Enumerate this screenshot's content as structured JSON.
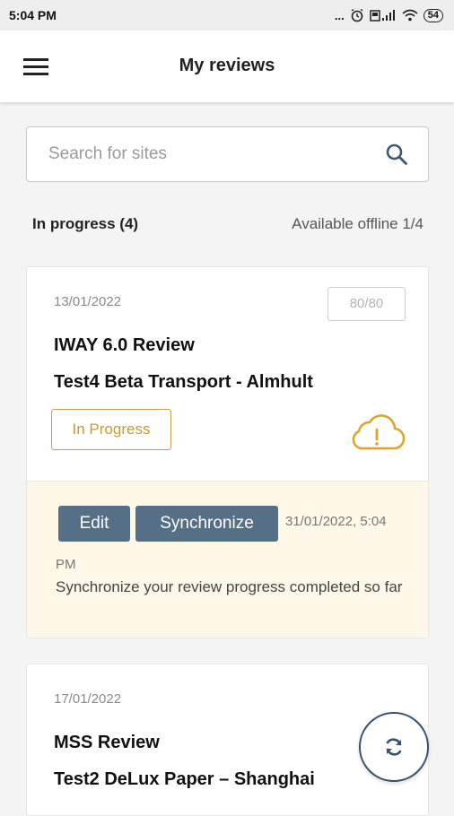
{
  "status_bar": {
    "time": "5:04 PM",
    "indicators": "...",
    "battery": "54"
  },
  "app_bar": {
    "title": "My reviews",
    "menu_icon": "hamburger-menu-icon"
  },
  "search": {
    "placeholder": "Search for sites",
    "value": "",
    "icon": "search-icon"
  },
  "section": {
    "title": "In progress (4)",
    "offline_status": "Available offline 1/4"
  },
  "reviews": [
    {
      "date": "13/01/2022",
      "score": "80/80",
      "review_name": "IWAY 6.0 Review",
      "site_name": "Test4 Beta Transport - Almhult",
      "status": "In Progress",
      "sync_icon": "cloud-warning-icon",
      "edit_label": "Edit",
      "sync_label": "Synchronize",
      "sync_date_part1": "31/01/2022, 5:04",
      "sync_date_part2": "PM",
      "sync_message": "Synchronize your review progress completed so far"
    },
    {
      "date": "17/01/2022",
      "review_name": "MSS Review",
      "site_name": "Test2 DeLux Paper – Shanghai"
    }
  ],
  "fab": {
    "icon": "refresh-icon"
  },
  "colors": {
    "primary_button": "#557086",
    "badge_accent": "#c9a142",
    "footer_bg": "#fdf8e7",
    "fab_border": "#38526a"
  }
}
